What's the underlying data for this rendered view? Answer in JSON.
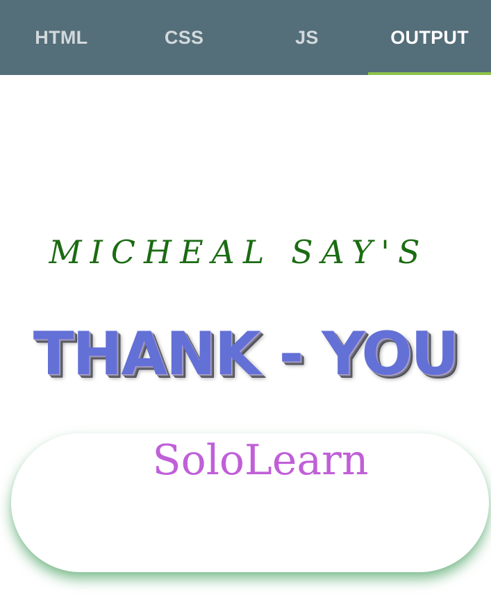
{
  "tabs": [
    {
      "label": "HTML"
    },
    {
      "label": "CSS"
    },
    {
      "label": "JS"
    },
    {
      "label": "OUTPUT"
    }
  ],
  "active_tab": "OUTPUT",
  "colors": {
    "tabbar": "#546e7a",
    "indicator": "#8bc34a",
    "says_text": "#1b6b12",
    "thank_text": "#6370d6",
    "brand_text": "#c05fd8",
    "card_shadow": "#1e8c3c"
  },
  "output": {
    "says": "MICHEAL SAY'S",
    "thank": "THANK - YOU",
    "brand": "SoloLearn"
  }
}
